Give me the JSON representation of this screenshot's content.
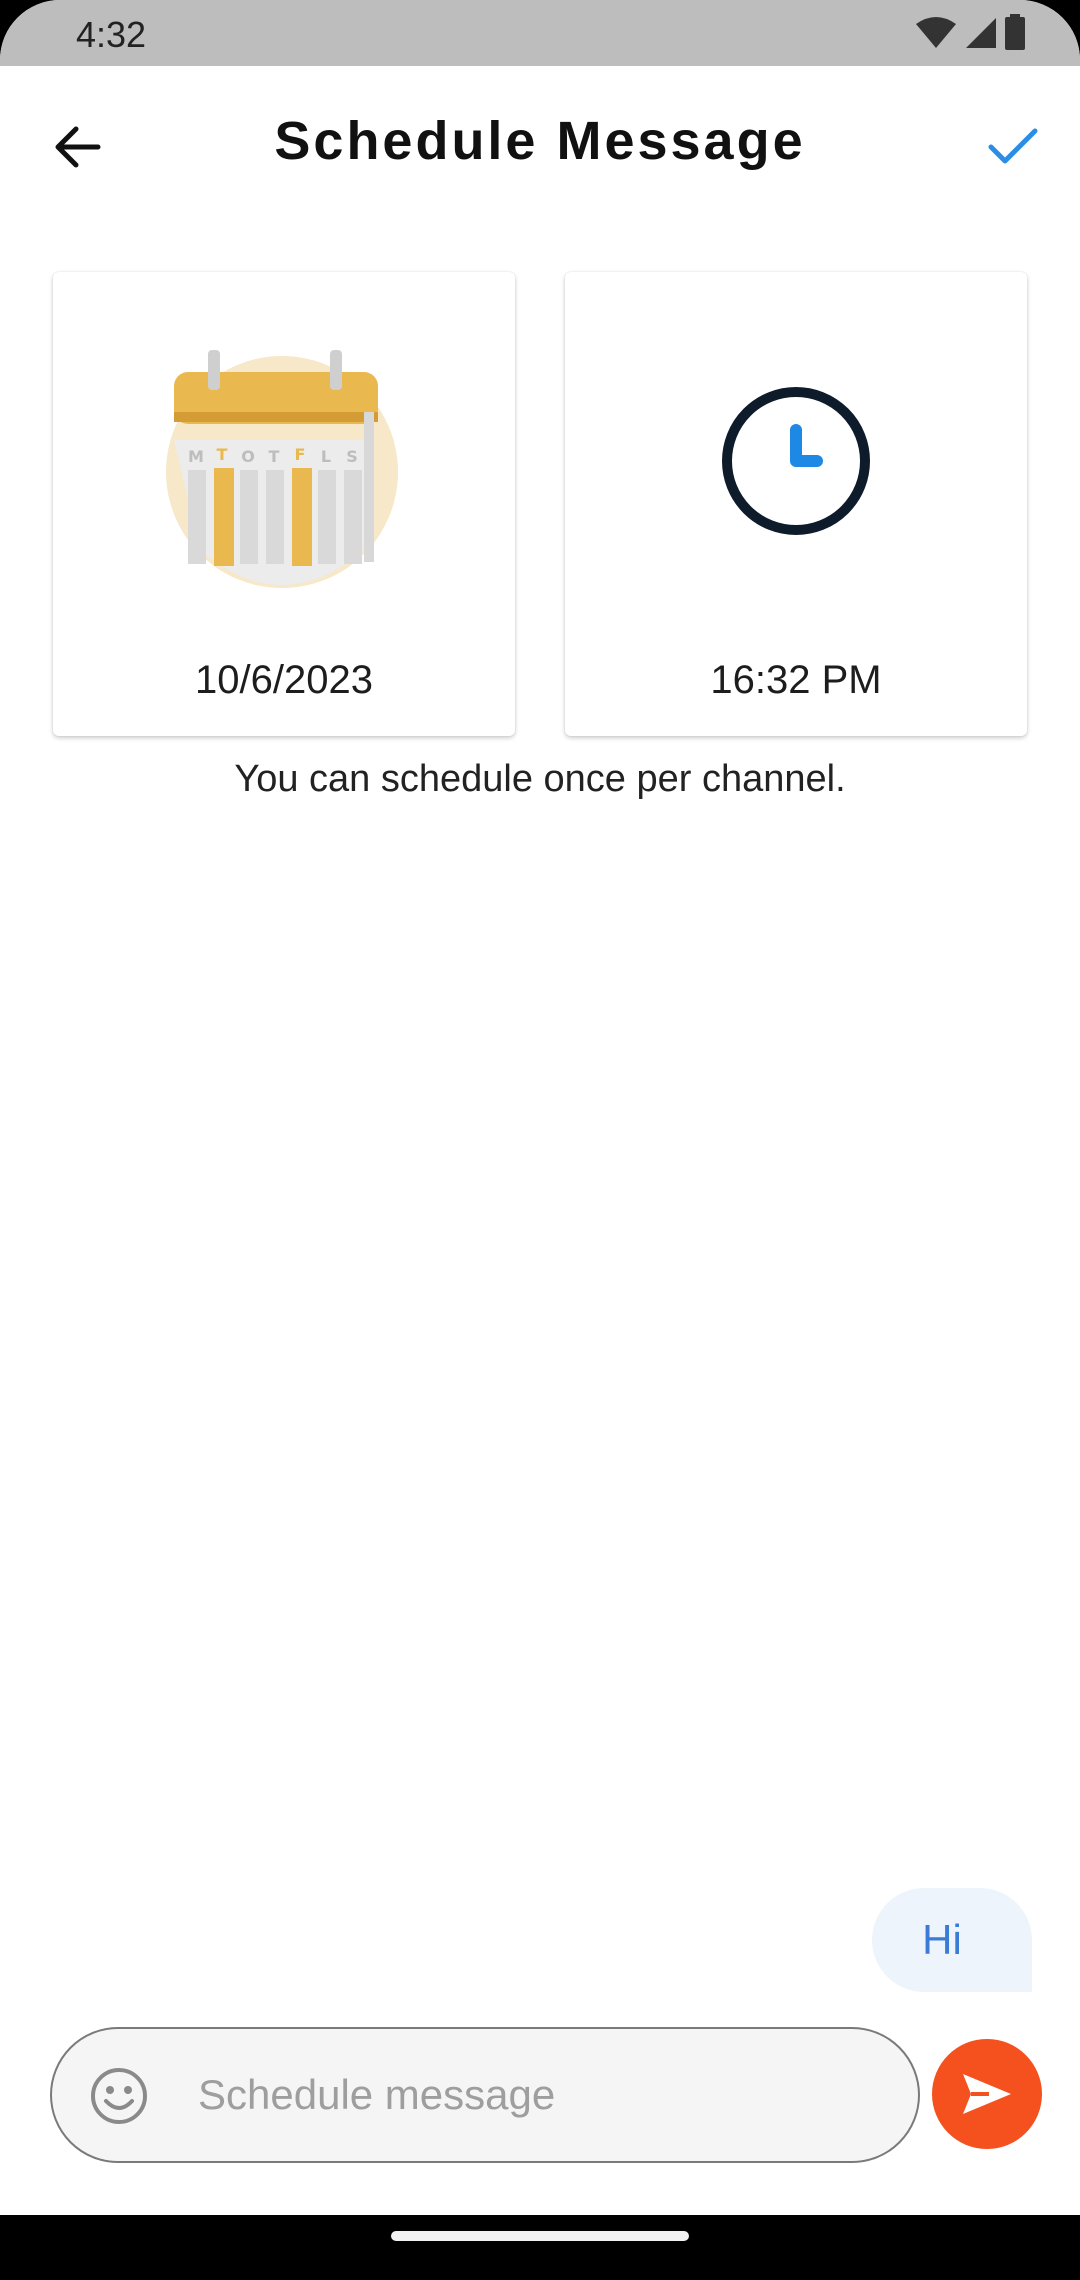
{
  "status_bar": {
    "time": "4:32",
    "icons": [
      "wifi-icon",
      "cell-signal-icon",
      "battery-icon"
    ]
  },
  "app_bar": {
    "title": "Schedule Message",
    "back_icon": "arrow-left-icon",
    "confirm_icon": "check-icon"
  },
  "date_card": {
    "value": "10/6/2023",
    "icon": "calendar-illustration",
    "weekdays": [
      "M",
      "T",
      "O",
      "T",
      "F",
      "L",
      "S"
    ]
  },
  "time_card": {
    "value": "16:32 PM",
    "icon": "clock-illustration"
  },
  "hint": "You can schedule once per channel.",
  "message_bubble": {
    "text": "Hi"
  },
  "composer": {
    "placeholder": "Schedule message",
    "value": "",
    "emoji_icon": "emoji-icon",
    "send_icon": "send-icon"
  },
  "colors": {
    "accent_blue": "#2b8ee6",
    "send_orange": "#f4511e",
    "bubble_bg": "#eef4fc",
    "bubble_text": "#3a7bd5",
    "calendar_yellow": "#e9b94f",
    "clock_navy": "#0d1b2a"
  }
}
